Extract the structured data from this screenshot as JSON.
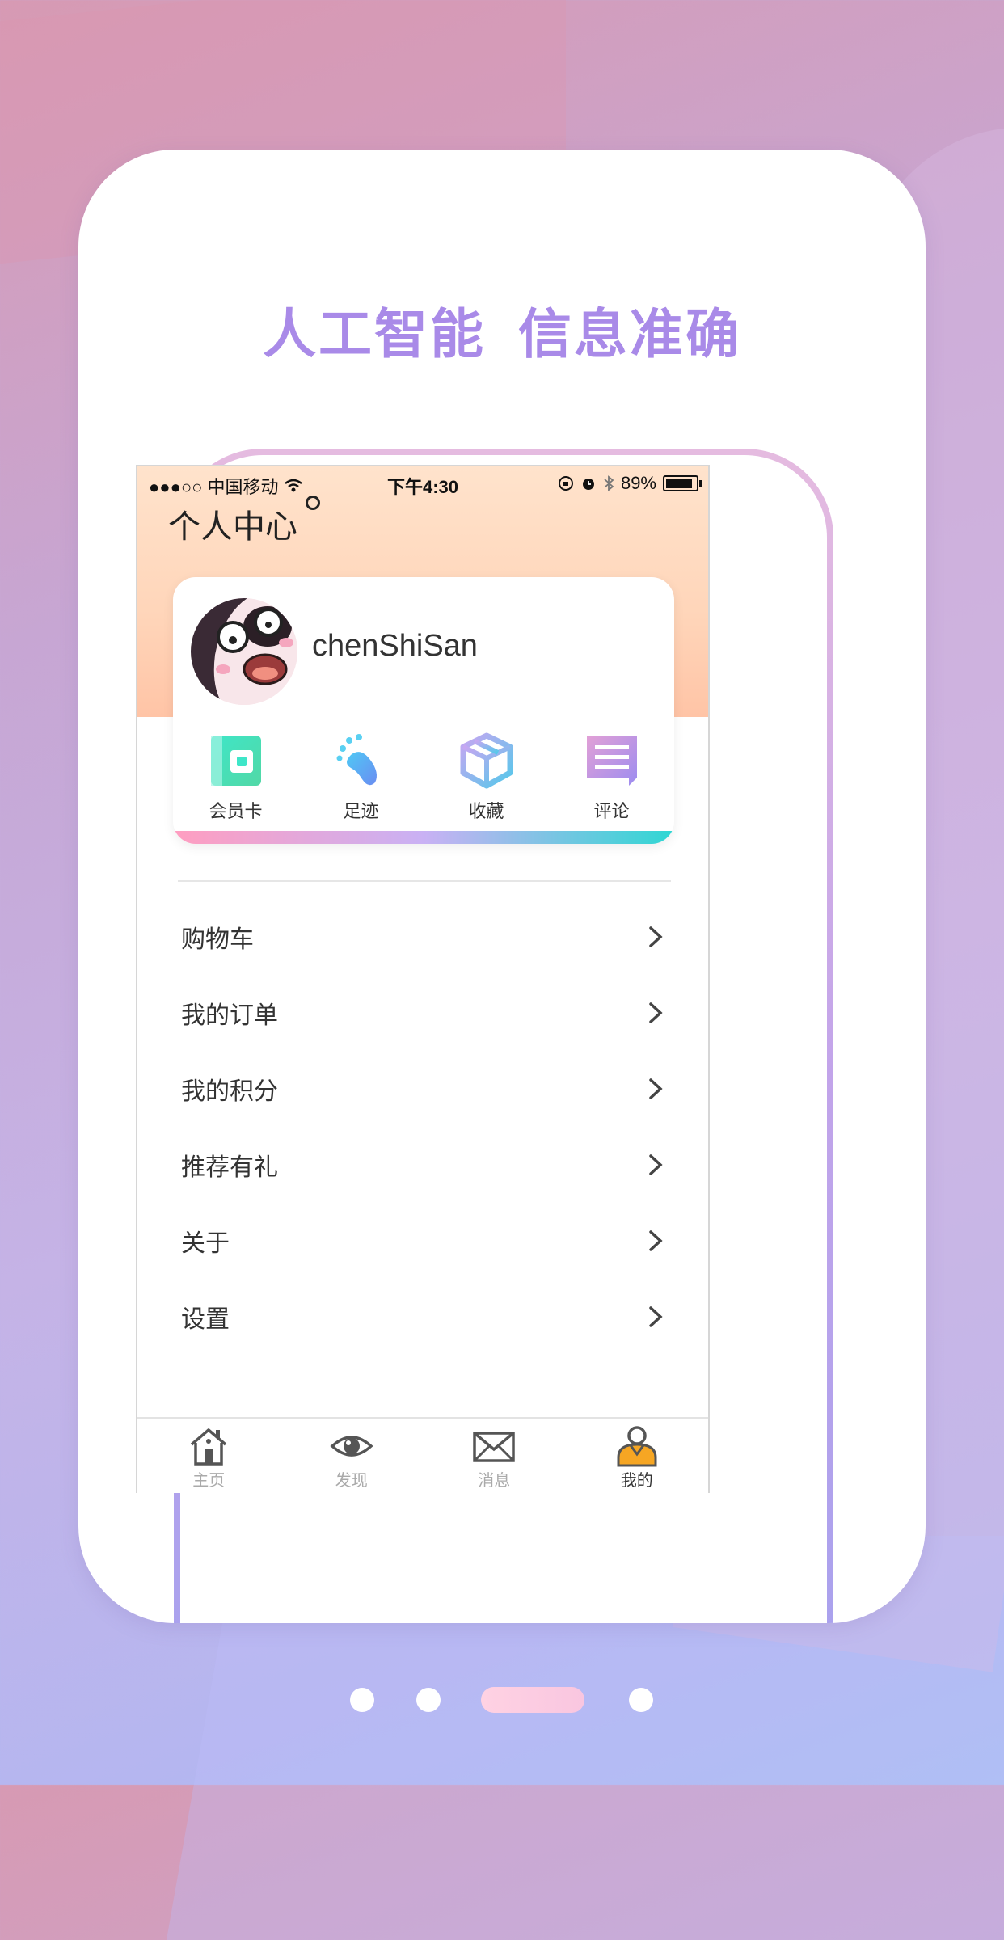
{
  "promo": {
    "headline_left": "人工智能",
    "headline_right": "信息准确"
  },
  "status_bar": {
    "carrier": "●●●○○ 中国移动",
    "time": "下午4:30",
    "battery": "89%"
  },
  "page": {
    "title": "个人中心"
  },
  "profile": {
    "username": "chenShiSan"
  },
  "shortcuts": [
    {
      "label": "会员卡",
      "icon": "member-card-icon"
    },
    {
      "label": "足迹",
      "icon": "footprint-icon"
    },
    {
      "label": "收藏",
      "icon": "collect-box-icon"
    },
    {
      "label": "评论",
      "icon": "comment-icon"
    }
  ],
  "menu": [
    {
      "label": "购物车"
    },
    {
      "label": "我的订单"
    },
    {
      "label": "我的积分"
    },
    {
      "label": "推荐有礼"
    },
    {
      "label": "关于"
    },
    {
      "label": "设置"
    }
  ],
  "tabbar": [
    {
      "label": "主页",
      "icon": "home-icon"
    },
    {
      "label": "发现",
      "icon": "eye-icon"
    },
    {
      "label": "消息",
      "icon": "mail-icon"
    },
    {
      "label": "我的",
      "icon": "user-icon",
      "active": true
    }
  ],
  "pager": {
    "total": 4,
    "active_index": 2
  },
  "colors": {
    "headline": "#a98ae8",
    "accent_tab": "#f6a623"
  }
}
